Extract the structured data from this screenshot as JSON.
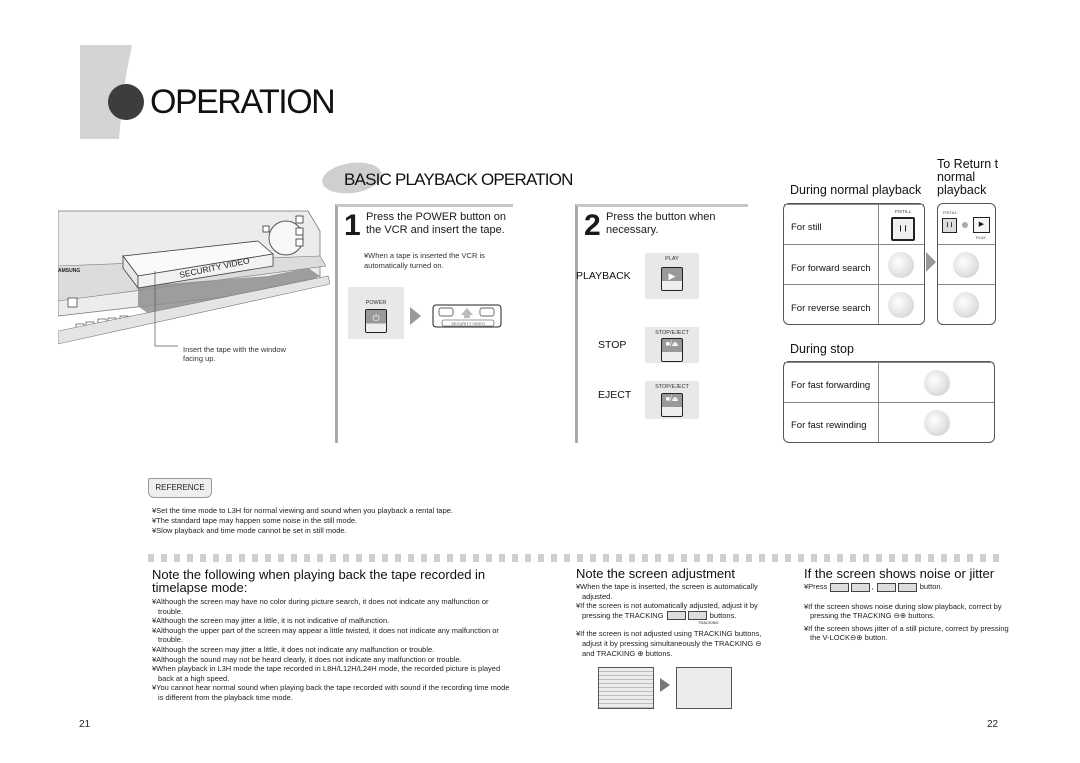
{
  "header": {
    "title": "OPERATION"
  },
  "section": {
    "title": "BASIC PLAYBACK OPERATION"
  },
  "illustration": {
    "brand": "AMSUNG",
    "cassette_label": "SECURITY VIDEO",
    "caption": "Insert the tape with the window facing up."
  },
  "step1": {
    "number": "1",
    "text": "Press the POWER button on the VCR and insert the tape.",
    "note": "¥When a tape is inserted the VCR is automatically turned on.",
    "power_label": "POWER",
    "cassette_label": "SECURITY VIDEO"
  },
  "step2": {
    "number": "2",
    "text": "Press the button when necessary.",
    "rows": [
      {
        "label": "PLAYBACK",
        "button_label": "PLAY",
        "glyph": "▶"
      },
      {
        "label": "STOP",
        "button_label": "STOP/EJECT",
        "glyph": "■/⏏"
      },
      {
        "label": "EJECT",
        "button_label": "STOP/EJECT",
        "glyph": "■/⏏"
      }
    ]
  },
  "normal_playback": {
    "heading": "During normal playback",
    "return_heading": "To Return to normal playback",
    "return_heading_visible": "To Return t",
    "return_heading_line2": "normal",
    "return_heading_line3": "playback",
    "rows": [
      {
        "label": "For still",
        "button_label": "P/STILL",
        "glyph": "❙❙"
      },
      {
        "label": "For forward search"
      },
      {
        "label": "For reverse search"
      }
    ],
    "return_still_label": "P/STILL",
    "return_play_label": "PLAY"
  },
  "during_stop": {
    "heading": "During stop",
    "rows": [
      {
        "label": "For fast forwarding"
      },
      {
        "label": "For fast rewinding"
      }
    ]
  },
  "reference": {
    "badge": "REFERENCE",
    "items": [
      "¥Set the time mode to L3H for normal viewing and sound when you playback a rental tape.",
      "¥The standard tape may happen some noise in the still mode.",
      "¥Slow playback and time mode cannot be set in still mode."
    ]
  },
  "timelapse": {
    "heading": "Note the following when playing back the tape recorded in timelapse mode:",
    "items": [
      "¥Although the screen may have no color during picture search, it does not indicate any malfunction or trouble.",
      "¥Although the screen may jitter a little, it is not indicative of malfunction.",
      "¥Although the upper part of the screen may appear a little twisted, it does not indicate any malfunction or trouble.",
      "¥Although the screen may jitter a little, it does not indicate any malfunction or trouble.",
      "¥Although the sound may not be heard clearly, it does not indicate any malfunction or trouble.",
      "¥When playback in L3H mode the tape recorded in L8H/L12H/L24H mode, the recorded picture is played back at a high speed.",
      "¥You cannot hear normal sound when playing back the tape recorded with sound if the recording time mode is different from the playback time mode."
    ]
  },
  "screen_adjust": {
    "heading": "Note the screen adjustment",
    "item1": "¥When the tape is inserted, the screen is automatically adjusted.",
    "item2_a": "¥If the screen is not automatically adjusted, adjust it by pressing the TRACKING",
    "item2_b": "buttons.",
    "tracking_label": "TRACKING",
    "item3": "¥If the screen is not adjusted using TRACKING buttons, adjust it by pressing simultaneously the TRACKING ⊖ and TRACKING ⊕ buttons."
  },
  "noise": {
    "heading": "If the screen shows noise or jitter",
    "press_a": "¥Press",
    "press_sep": ",",
    "press_b": "button.",
    "item2": "¥If the screen shows noise during slow playback, correct by pressing the TRACKING ⊖⊕ buttons.",
    "item3": "¥If the screen shows jitter of a still picture, correct by pressing the V-LOCK⊖⊕ button."
  },
  "pages": {
    "left": "21",
    "right": "22"
  }
}
